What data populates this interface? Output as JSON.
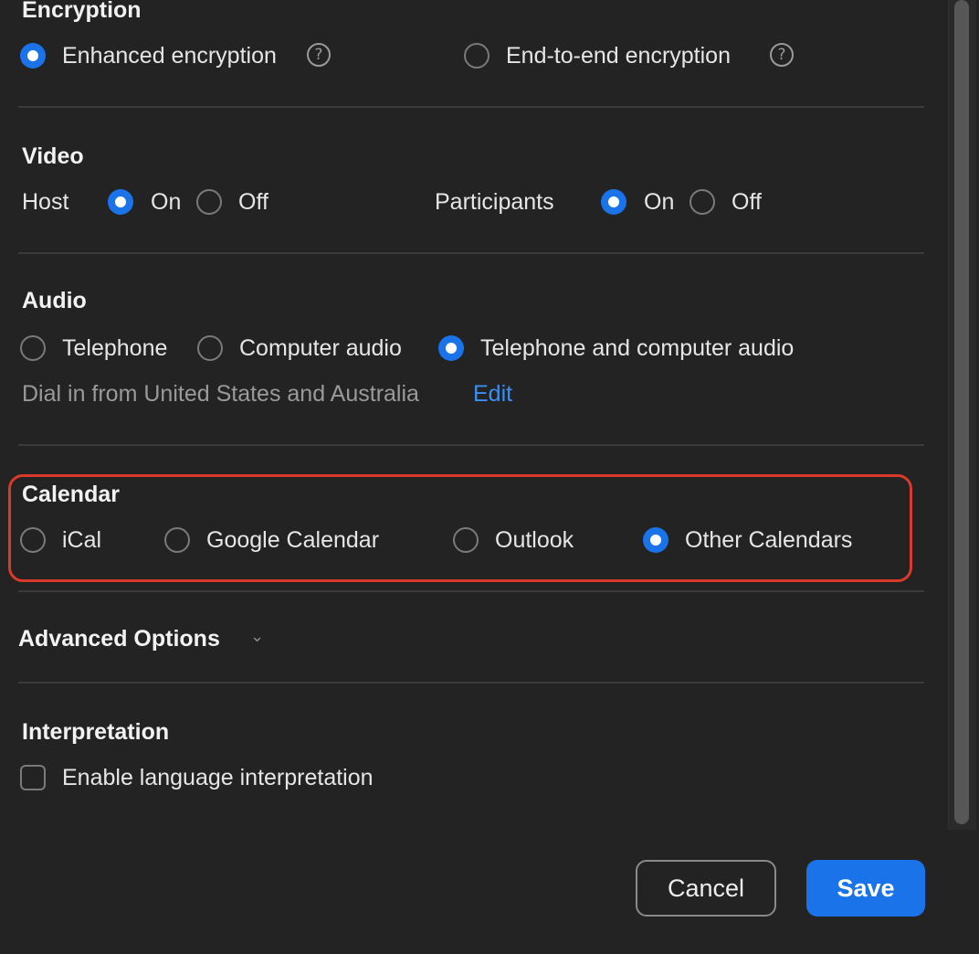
{
  "encryption": {
    "title": "Encryption",
    "options": [
      {
        "label": "Enhanced encryption",
        "checked": true
      },
      {
        "label": "End-to-end encryption",
        "checked": false
      }
    ],
    "help_glyph": "?"
  },
  "video": {
    "title": "Video",
    "host_label": "Host",
    "participants_label": "Participants",
    "on_label": "On",
    "off_label": "Off",
    "host_value": "On",
    "participants_value": "On"
  },
  "audio": {
    "title": "Audio",
    "options": [
      {
        "label": "Telephone",
        "checked": false
      },
      {
        "label": "Computer audio",
        "checked": false
      },
      {
        "label": "Telephone and computer audio",
        "checked": true
      }
    ],
    "dial_in_text": "Dial in from United States and Australia",
    "edit_label": "Edit"
  },
  "calendar": {
    "title": "Calendar",
    "options": [
      {
        "label": "iCal",
        "checked": false
      },
      {
        "label": "Google Calendar",
        "checked": false
      },
      {
        "label": "Outlook",
        "checked": false
      },
      {
        "label": "Other Calendars",
        "checked": true
      }
    ]
  },
  "advanced": {
    "title": "Advanced Options",
    "chevron_glyph": "⌄"
  },
  "interpretation": {
    "title": "Interpretation",
    "checkbox_label": "Enable language interpretation",
    "checked": false
  },
  "buttons": {
    "cancel": "Cancel",
    "save": "Save"
  },
  "colors": {
    "accent": "#1a73e8",
    "link": "#3a8ff0",
    "highlight": "#d93a2b",
    "background": "#232323"
  }
}
